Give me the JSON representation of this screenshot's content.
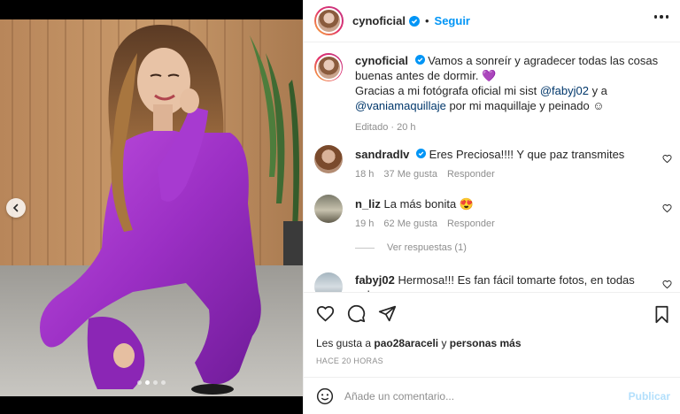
{
  "header": {
    "username": "cynoficial",
    "separator": "•",
    "follow_label": "Seguir"
  },
  "caption": {
    "username": "cynoficial",
    "text_1": "Vamos a sonreír y agradecer todas las cosas buenas antes de dormir.",
    "emoji": "💜",
    "text_2": "Gracias a mi fotógrafa oficial mi sist",
    "mention_1": "@fabyj02",
    "text_3": "y a",
    "mention_2": "@vaniamaquillaje",
    "text_4": "por mi maquillaje y peinado ☺",
    "meta": "Editado · 20 h"
  },
  "comments": [
    {
      "username": "sandradlv",
      "verified": true,
      "text": "Eres Preciosa!!!! Y que paz transmites",
      "time": "18 h",
      "likes": "37 Me gusta",
      "reply": "Responder"
    },
    {
      "username": "n_liz",
      "verified": false,
      "text": "La más bonita 😍",
      "time": "19 h",
      "likes": "62 Me gusta",
      "reply": "Responder"
    },
    {
      "username": "fabyj02",
      "verified": false,
      "text": "Hermosa!!! Es fan fácil tomarte fotos, en todas sales"
    }
  ],
  "replies_label": "Ver respuestas (1)",
  "likes": {
    "prefix": "Les gusta a",
    "user": "pao28araceli",
    "middle": "y",
    "others": "personas más"
  },
  "timestamp": "HACE 20 HORAS",
  "composer": {
    "placeholder": "Añade un comentario...",
    "publish_label": "Publicar"
  },
  "carousel": {
    "total": 4,
    "active": 2
  },
  "colors": {
    "accent": "#0095f6",
    "verified": "#0095f6",
    "suit": "#9b2fc4"
  },
  "icons": [
    "chevron-left-icon",
    "verified-badge-icon",
    "more-options-icon",
    "heart-icon",
    "comment-icon",
    "share-icon",
    "bookmark-icon",
    "emoji-icon"
  ]
}
